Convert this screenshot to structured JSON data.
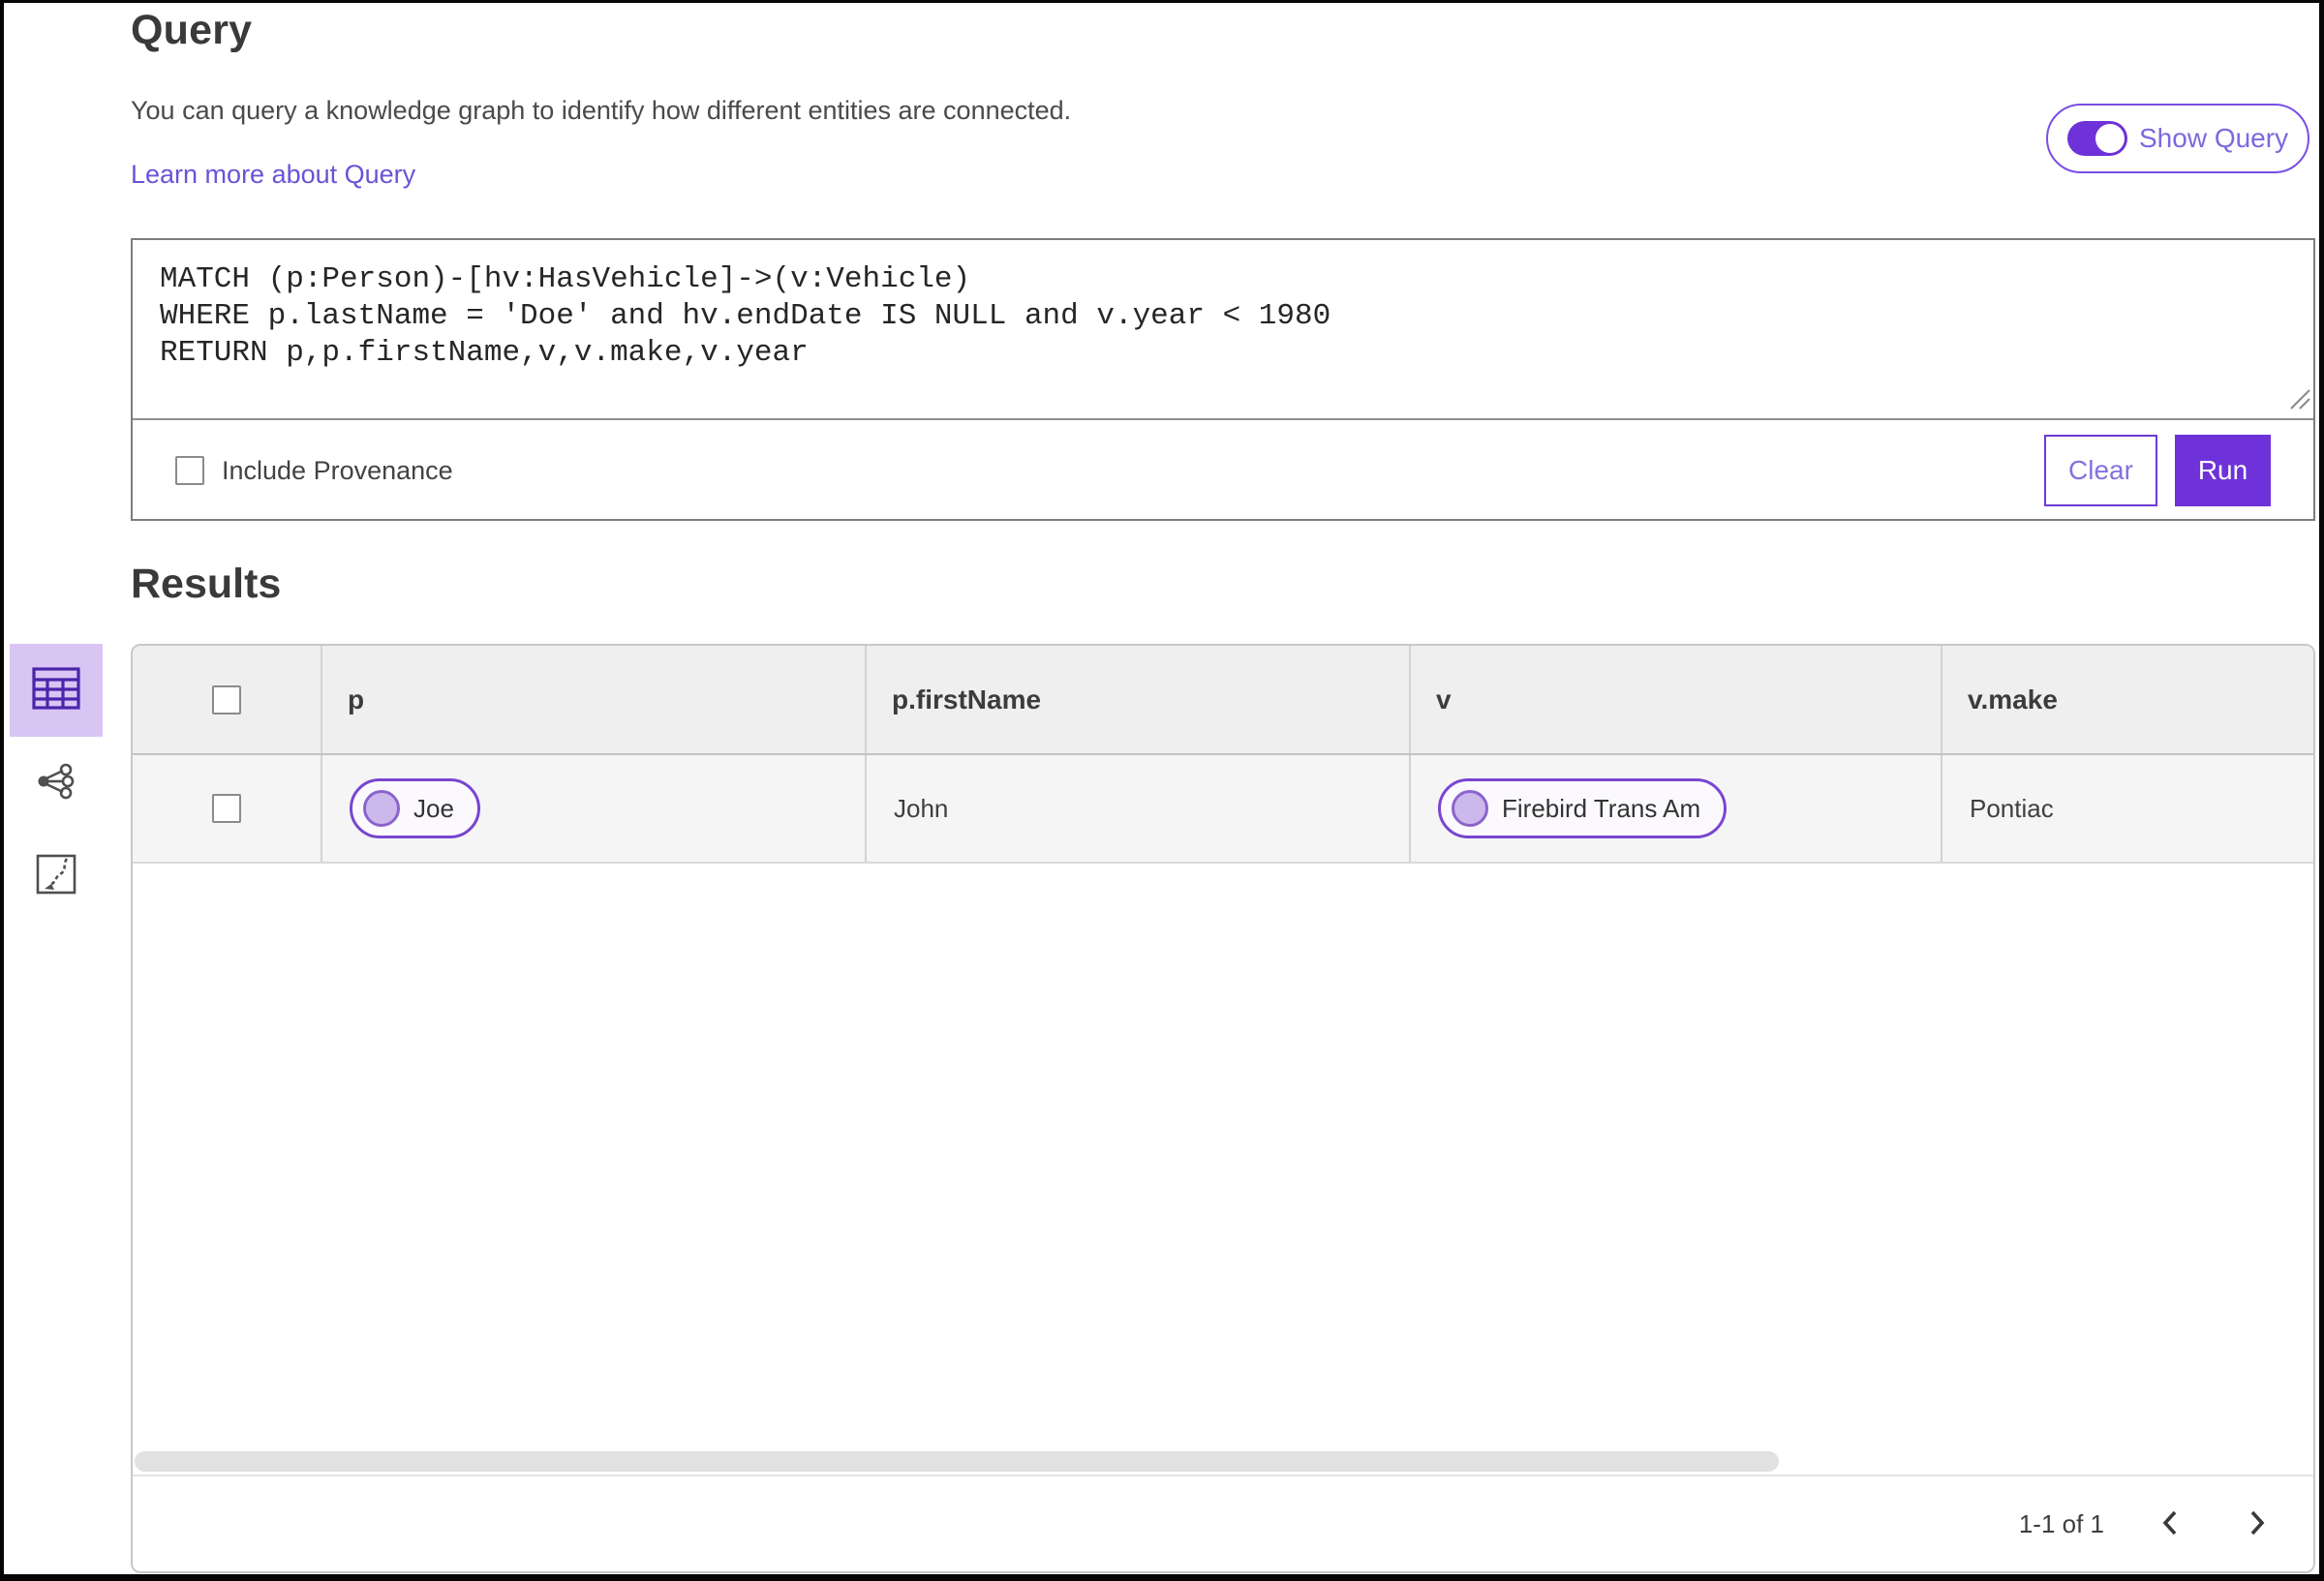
{
  "header": {
    "title": "Query",
    "description": "You can query a knowledge graph to identify how different entities are connected.",
    "learn_more_link": "Learn more about Query",
    "show_query": {
      "label": "Show Query",
      "state": "on"
    }
  },
  "query_editor": {
    "code": "MATCH (p:Person)-[hv:HasVehicle]->(v:Vehicle)\nWHERE p.lastName = 'Doe' and hv.endDate IS NULL and v.year < 1980\nRETURN p,p.firstName,v,v.make,v.year",
    "include_provenance": {
      "label": "Include Provenance",
      "checked": false
    },
    "buttons": {
      "clear": "Clear",
      "run": "Run"
    }
  },
  "results": {
    "heading": "Results",
    "view_rail": {
      "icons": [
        "table-view-icon",
        "network-view-icon",
        "map-view-icon"
      ],
      "selected": "table-view-icon"
    },
    "table": {
      "columns": [
        "p",
        "p.firstName",
        "v",
        "v.make"
      ],
      "select_all_checked": false,
      "rows": [
        {
          "checked": false,
          "p": {
            "type": "entity-chip",
            "label": "Joe"
          },
          "p_firstName": "John",
          "v": {
            "type": "entity-chip",
            "label": "Firebird Trans Am"
          },
          "v_make": "Pontiac"
        }
      ]
    },
    "pagination": {
      "range_label": "1-1 of 1",
      "icons": [
        "chevron-left-icon",
        "chevron-right-icon"
      ]
    }
  },
  "colors": {
    "primary_purple": "#6e32d8",
    "link_purple": "#6a53d7",
    "toggle_outline_purple": "#7a4ee2",
    "chip_border_purple": "#7a45d0",
    "chip_avatar_fill": "#ccb8ec",
    "selected_view_bg": "#d8c5f4",
    "table_header_bg": "#efeff0",
    "table_row_bg": "#f5f5f6"
  }
}
